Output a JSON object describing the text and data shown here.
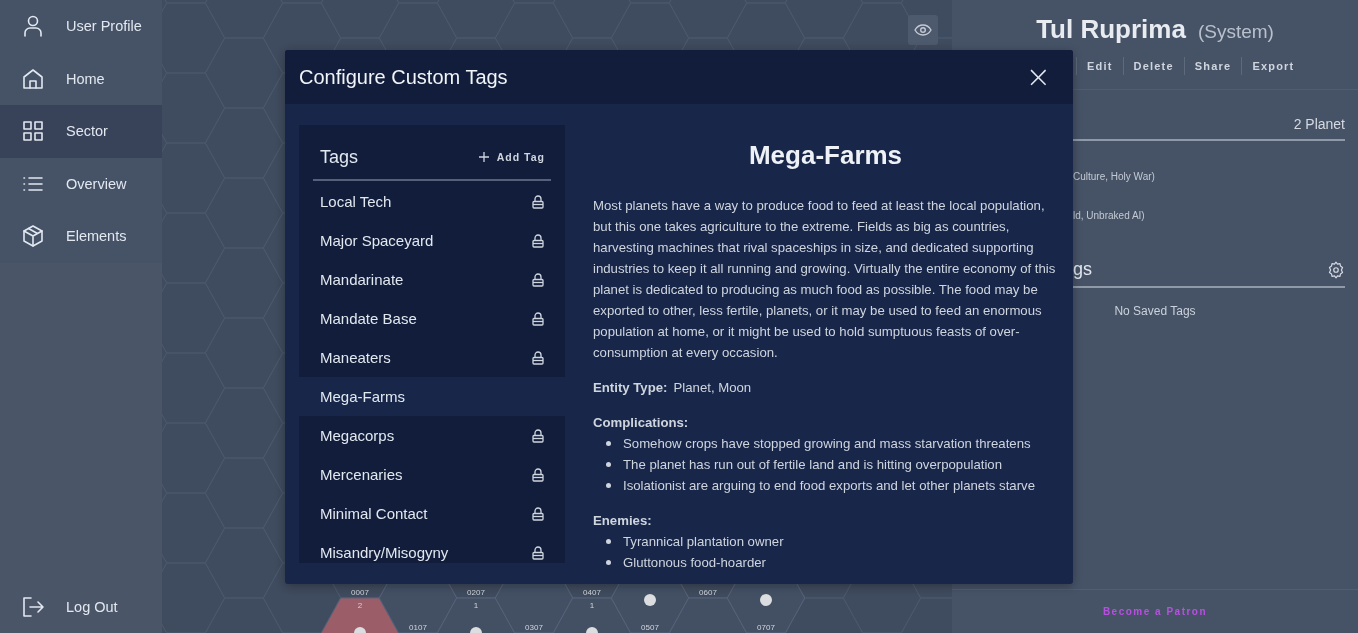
{
  "sidebar": {
    "items": [
      {
        "label": "User Profile",
        "selected": false
      },
      {
        "label": "Home",
        "selected": false
      },
      {
        "label": "Sector",
        "selected": true
      },
      {
        "label": "Overview",
        "selected": false
      },
      {
        "label": "Elements",
        "selected": false
      }
    ],
    "logout": {
      "label": "Log Out"
    }
  },
  "map": {
    "hexes": [
      {
        "id": "0007",
        "count": "2",
        "planet": true,
        "highlighted": true
      },
      {
        "id": "0107",
        "planet": false,
        "highlighted": false
      },
      {
        "id": "0207",
        "count": "1",
        "planet": true,
        "highlighted": false
      },
      {
        "id": "0307",
        "planet": false,
        "highlighted": false
      },
      {
        "id": "0407",
        "count": "1",
        "planet": true,
        "highlighted": false
      },
      {
        "id": "0507",
        "planet": true,
        "highlighted": false
      },
      {
        "id": "0607",
        "planet": false,
        "highlighted": false
      },
      {
        "id": "0707",
        "planet": true,
        "highlighted": false
      }
    ]
  },
  "system_panel": {
    "title": "Tul Ruprima",
    "subtitle": "(System)",
    "actions": [
      "Edit",
      "Delete",
      "Share",
      "Export"
    ],
    "count_label": "2 Planet",
    "tag_lines": [
      "Culture, Holy War)",
      "ld, Unbraked AI)"
    ],
    "saved_tags": {
      "heading": "gs",
      "empty": "No Saved Tags"
    },
    "footer_link": "Become a Patron"
  },
  "modal": {
    "title": "Configure Custom Tags",
    "close": "×",
    "tags": {
      "heading": "Tags",
      "add_label": "Add Tag",
      "items": [
        {
          "label": "Local Tech",
          "locked": true,
          "selected": false
        },
        {
          "label": "Major Spaceyard",
          "locked": true,
          "selected": false
        },
        {
          "label": "Mandarinate",
          "locked": true,
          "selected": false
        },
        {
          "label": "Mandate Base",
          "locked": true,
          "selected": false
        },
        {
          "label": "Maneaters",
          "locked": true,
          "selected": false
        },
        {
          "label": "Mega-Farms",
          "locked": false,
          "selected": true
        },
        {
          "label": "Megacorps",
          "locked": true,
          "selected": false
        },
        {
          "label": "Mercenaries",
          "locked": true,
          "selected": false
        },
        {
          "label": "Minimal Contact",
          "locked": true,
          "selected": false
        },
        {
          "label": "Misandry/Misogyny",
          "locked": true,
          "selected": false
        }
      ]
    },
    "detail": {
      "title": "Mega-Farms",
      "description": "Most planets have a way to produce food to feed at least the local population, but this one takes agriculture to the extreme. Fields as big as countries, harvesting machines that rival spaceships in size, and dedicated supporting industries to keep it all running and growing. Virtually the entire economy of this planet is dedicated to producing as much food as possible. The food may be exported to other, less fertile, planets, or it may be used to feed an enormous population at home, or it might be used to hold sumptuous feasts of over-consumption at every occasion.",
      "entity_type_label": "Entity Type:",
      "entity_type": "Planet, Moon",
      "sections": [
        {
          "heading": "Complications:",
          "items": [
            "Somehow crops have stopped growing and mass starvation threatens",
            "The planet has run out of fertile land and is hitting overpopulation",
            "Isolationist are arguing to end food exports and let other planets starve"
          ]
        },
        {
          "heading": "Enemies:",
          "items": [
            "Tyrannical plantation owner",
            "Gluttonous food-hoarder"
          ]
        }
      ]
    }
  }
}
